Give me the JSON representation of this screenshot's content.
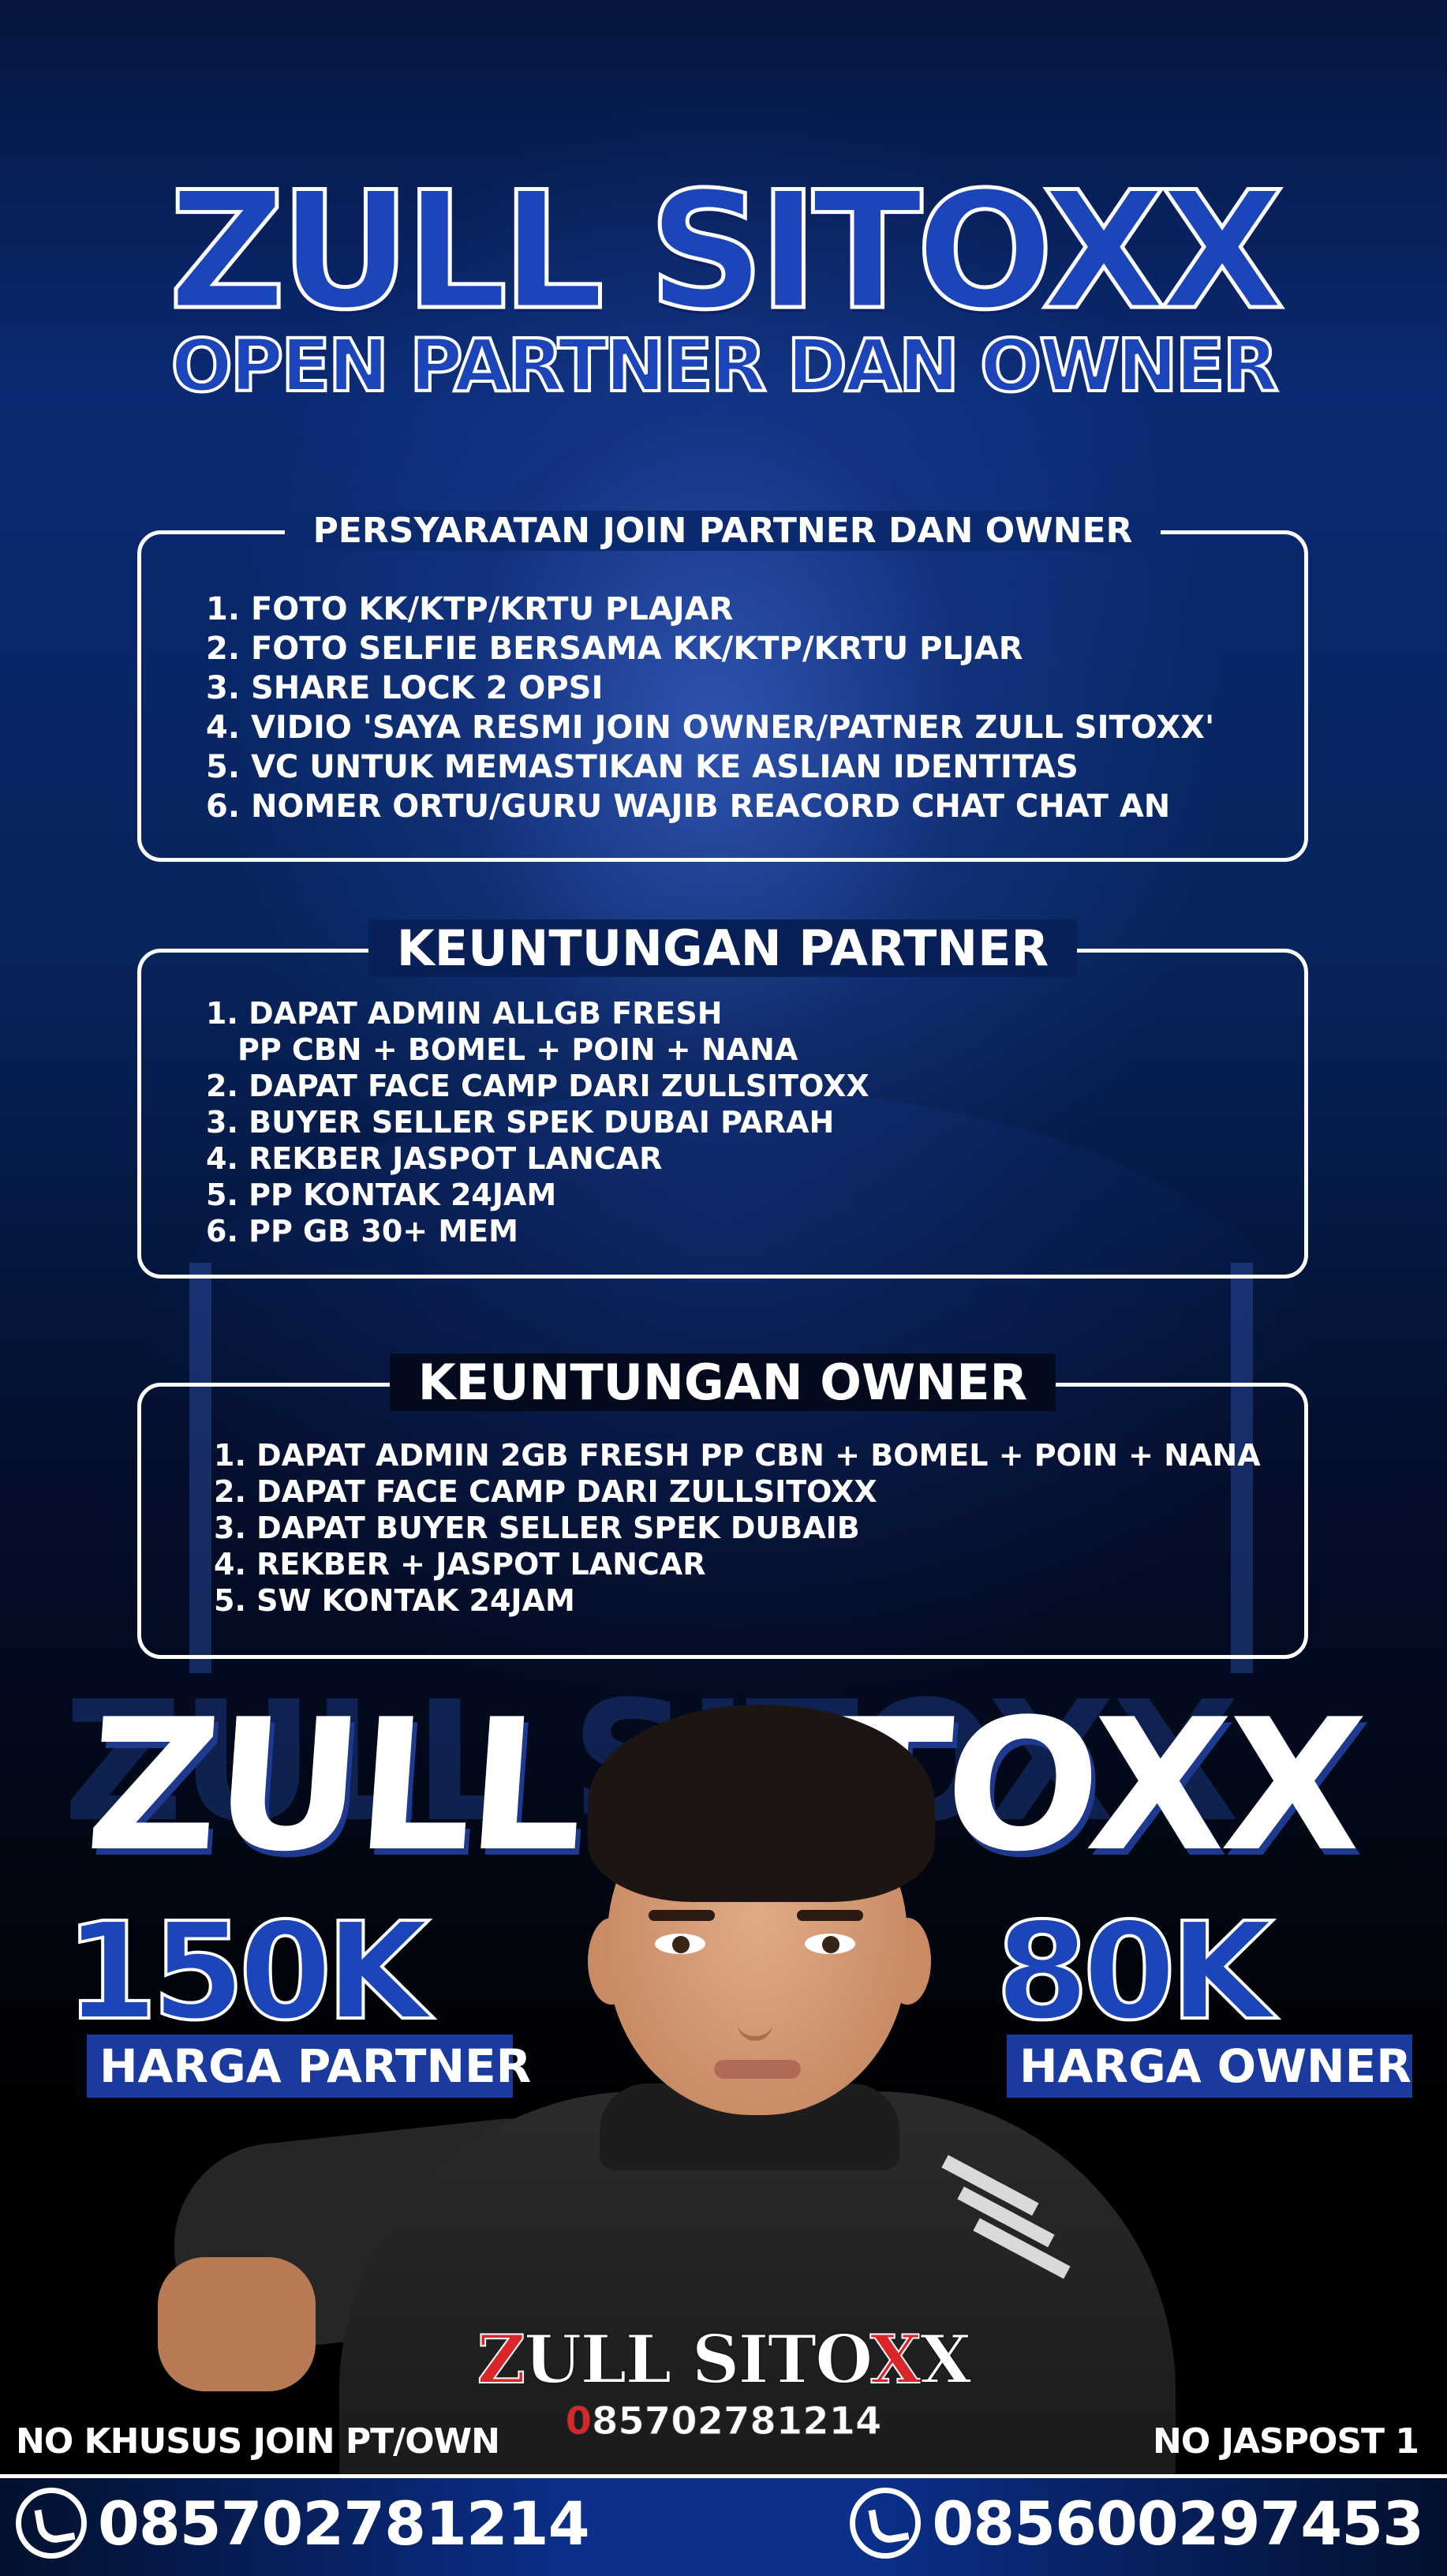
{
  "header": {
    "title": "ZULL SITOXX",
    "subtitle": "OPEN PARTNER DAN OWNER"
  },
  "requirements": {
    "title": "PERSYARATAN JOIN PARTNER DAN OWNER",
    "items": [
      "1. FOTO KK/KTP/KRTU PLAJAR",
      "2. FOTO SELFIE BERSAMA KK/KTP/KRTU PLJAR",
      "3. SHARE LOCK 2 OPSI",
      "4. VIDIO 'SAYA RESMI JOIN OWNER/PATNER ZULL SITOXX'",
      "5. VC UNTUK MEMASTIKAN KE ASLIAN IDENTITAS",
      "6. NOMER ORTU/GURU WAJIB REACORD CHAT CHAT AN"
    ]
  },
  "partner_benefits": {
    "title": "KEUNTUNGAN PARTNER",
    "items": [
      "1. DAPAT ADMIN ALLGB FRESH",
      "    PP CBN + BOMEL + POIN + NANA",
      "2. DAPAT FACE CAMP DARI ZULLSITOXX",
      "3. BUYER SELLER SPEK DUBAI PARAH",
      "4. REKBER JASPOT LANCAR",
      "5. PP KONTAK 24JAM",
      "6. PP GB 30+ MEM"
    ]
  },
  "owner_benefits": {
    "title": "KEUNTUNGAN OWNER",
    "items": [
      "1. DAPAT ADMIN 2GB FRESH PP CBN + BOMEL + POIN + NANA",
      "2. DAPAT FACE CAMP DARI ZULLSITOXX",
      "3. DAPAT BUYER SELLER SPEK DUBAIB",
      "4. REKBER + JASPOT LANCAR",
      "5. SW KONTAK 24JAM"
    ]
  },
  "brand_banner": "ZULL SITOXX",
  "pricing": {
    "partner": {
      "price": "150K",
      "label": "HARGA PARTNER"
    },
    "owner": {
      "price": "80K",
      "label": "HARGA OWNER"
    }
  },
  "logo": {
    "text_red_1": "Z",
    "text_white_1": "ULL SITO",
    "text_red_2": "X",
    "text_white_2": "X",
    "phone_red_1": "0",
    "phone_white": "85702781214",
    "phone_red_2": "",
    "phone_full": "085702781214"
  },
  "footer": {
    "left_label": "NO KHUSUS JOIN PT/OWN",
    "right_label": "NO JASPOST 1",
    "left_number": "085702781214",
    "right_number": "085600297453",
    "icon": "whatsapp-icon"
  },
  "colors": {
    "title_blue": "#1b45b8",
    "label_blue": "#1a3aa0",
    "logo_red": "#d8262a",
    "background_dark": "#041030"
  }
}
